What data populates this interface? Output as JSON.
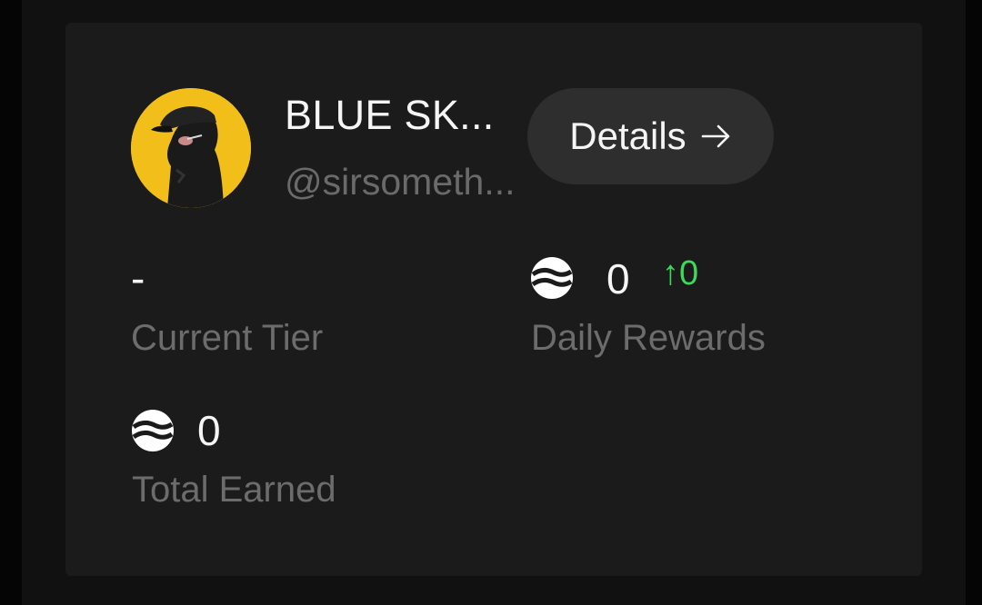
{
  "profile": {
    "name": "BLUE SK...",
    "handle": "@sirsometh...",
    "avatar_bg": "#f2bf1a"
  },
  "details_button": {
    "label": "Details",
    "icon": "arrow-right-icon"
  },
  "stats": {
    "current_tier": {
      "value": "-",
      "label": "Current Tier"
    },
    "daily_rewards": {
      "icon": "token-icon",
      "value": "0",
      "delta": "↑0",
      "delta_color": "#3cd95a",
      "label": "Daily Rewards"
    },
    "total_earned": {
      "icon": "token-icon",
      "value": "0",
      "label": "Total Earned"
    }
  },
  "colors": {
    "card_bg": "#1b1b1b",
    "button_bg": "#2e2e2e",
    "primary_text": "#f5f5f5",
    "secondary_text": "#6c6c6c"
  }
}
